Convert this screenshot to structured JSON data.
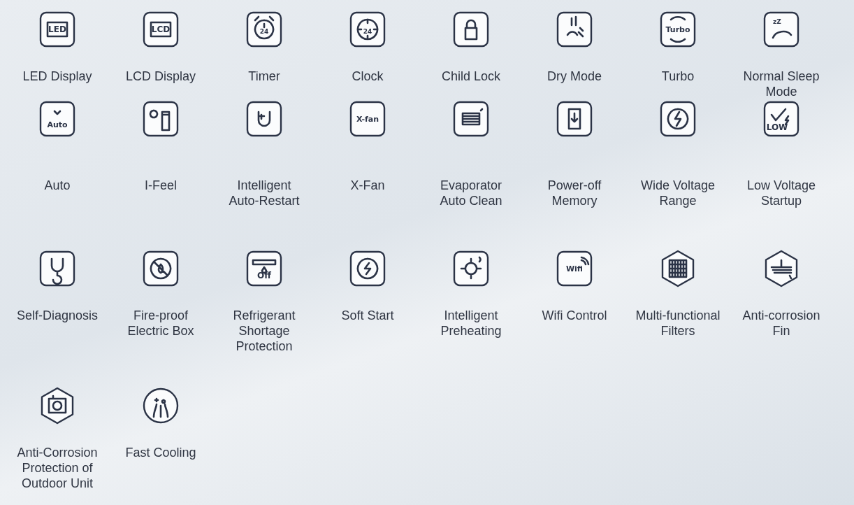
{
  "features": [
    {
      "label": "LED Display",
      "kind": "square",
      "glyph": "LED"
    },
    {
      "label": "LCD Display",
      "kind": "square",
      "glyph": "LCD"
    },
    {
      "label": "Timer",
      "kind": "square",
      "glyph": "24"
    },
    {
      "label": "Clock",
      "kind": "square",
      "glyph": "24"
    },
    {
      "label": "Child Lock",
      "kind": "square"
    },
    {
      "label": "Dry Mode",
      "kind": "square"
    },
    {
      "label": "Turbo",
      "kind": "square",
      "glyph": "Turbo"
    },
    {
      "label": "Normal Sleep Mode",
      "kind": "square",
      "glyph": "zZ"
    },
    {
      "label": "Auto",
      "kind": "square",
      "glyph": "Auto"
    },
    {
      "label": "I-Feel",
      "kind": "square"
    },
    {
      "label": "Intelligent Auto-Restart",
      "kind": "square"
    },
    {
      "label": "X-Fan",
      "kind": "square",
      "glyph": "X-fan"
    },
    {
      "label": "Evaporator Auto Clean",
      "kind": "square"
    },
    {
      "label": "Power-off Memory",
      "kind": "square"
    },
    {
      "label": "Wide Voltage Range",
      "kind": "square"
    },
    {
      "label": "Low Voltage Startup",
      "kind": "square",
      "glyph": "LOW"
    },
    {
      "label": "Self-Diagnosis",
      "kind": "square"
    },
    {
      "label": "Fire-proof Electric Box",
      "kind": "square"
    },
    {
      "label": "Refrigerant Shortage Protection",
      "kind": "square",
      "glyph": "Off"
    },
    {
      "label": "Soft Start",
      "kind": "square"
    },
    {
      "label": "Intelligent Preheating",
      "kind": "square"
    },
    {
      "label": "Wifi Control",
      "kind": "square",
      "glyph": "Wifi"
    },
    {
      "label": "Multi-functional Filters",
      "kind": "hexagon"
    },
    {
      "label": "Anti-corrosion Fin",
      "kind": "hexagon"
    },
    {
      "label": "Anti-Corrosion Protection of Outdoor Unit",
      "kind": "hexagon"
    },
    {
      "label": "Fast Cooling",
      "kind": "circle"
    }
  ]
}
